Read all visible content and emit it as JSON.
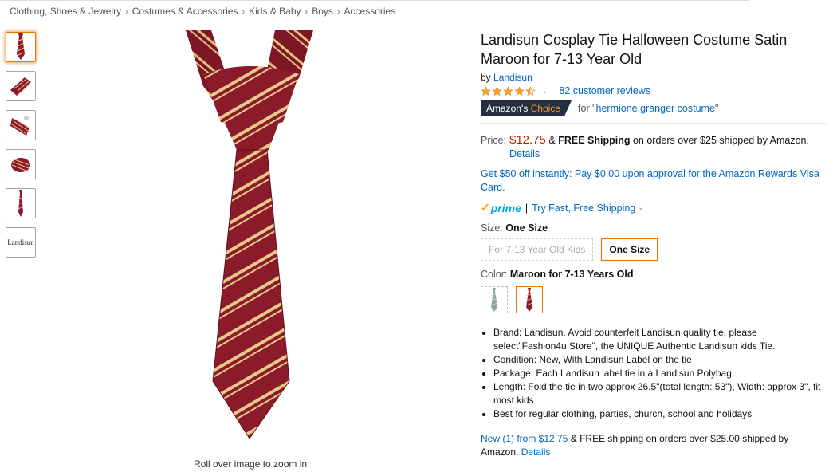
{
  "breadcrumb": [
    "Clothing, Shoes & Jewelry",
    "Costumes & Accessories",
    "Kids & Baby",
    "Boys",
    "Accessories"
  ],
  "breadcrumb_separator": "›",
  "thumbnail_text": "Landisun",
  "zoom_hint": "Roll over image to zoom in",
  "product": {
    "title": "Landisun Cosplay Tie Halloween Costume Satin Maroon for 7-13 Year Old",
    "by_label": "by",
    "brand": "Landisun",
    "rating": 4.5,
    "reviews": "82 customer reviews",
    "choice": {
      "badge_prefix": "Amazon's",
      "badge_accent": "Choice",
      "for_prefix": "for \"",
      "for_term": "hermione granger costume",
      "for_suffix": "\""
    },
    "price": {
      "label": "Price:",
      "amount": "$12.75",
      "amp": "&",
      "free_shipping": "FREE Shipping",
      "rest": "on orders over $25 shipped by Amazon.",
      "details": "Details"
    },
    "offer": "Get $50 off instantly: Pay $0.00 upon approval for the Amazon Rewards Visa Card.",
    "prime": {
      "logo": "prime",
      "pipe": "|",
      "link": "Try Fast, Free Shipping"
    },
    "size": {
      "label": "Size:",
      "selected": "One Size",
      "options": [
        "For 7-13 Year Old Kids",
        "One Size"
      ]
    },
    "color": {
      "label": "Color:",
      "selected": "Maroon for 7-13 Years Old"
    },
    "bullets": [
      "Brand: Landisun. Avoid counterfeit Landisun quality tie, please select\"Fashion4u Store\", the UNIQUE Authentic Landisun kids Tie.",
      "Condition: New, With Landisun Label on the tie",
      "Package: Each Landisun label tie in a Landisun Polybag",
      "Length: Fold the tie in two approx 26.5\"(total length: 53\"), Width: approx 3\", fit most kids",
      "Best for regular clothing, parties, church, school and holidays"
    ],
    "new_offers": {
      "link": "New (1) from $12.75",
      "rest": "& FREE shipping on orders over $25.00 shipped by Amazon.",
      "details": "Details"
    }
  },
  "colors": {
    "link": "#0066c0",
    "price": "#b12704",
    "tie_maroon": "#8b1a2b",
    "tie_stripe": "#e8c98a",
    "badge_bg": "#232f3e",
    "badge_accent": "#f69931",
    "star": "#ffa41c"
  }
}
